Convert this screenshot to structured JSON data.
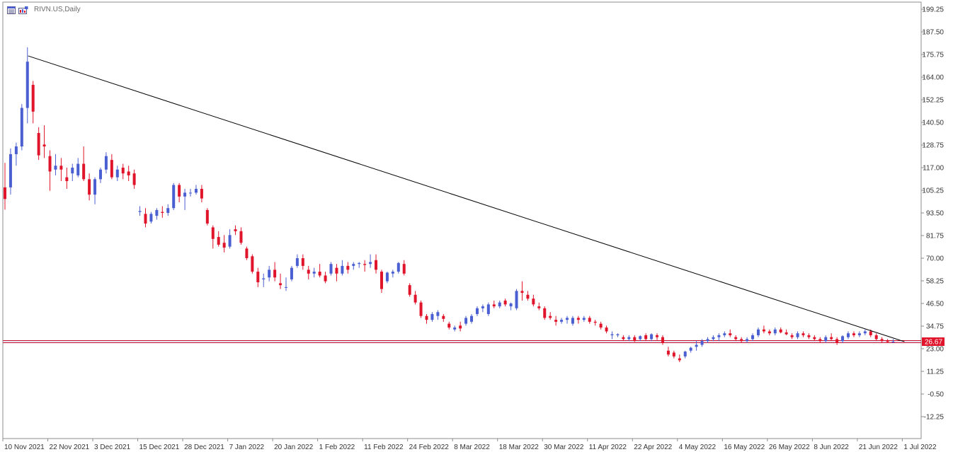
{
  "header": {
    "symbol_label": "RIVN.US,Daily",
    "icons": [
      "chart-window-icon",
      "chart-properties-icon"
    ]
  },
  "colors": {
    "bull": "#4a5fd1",
    "bear": "#e0142a",
    "trendline": "#000000",
    "price_line": "#c8102e",
    "price_badge_bg": "#e0142a",
    "grid_frame": "#8c8c8c"
  },
  "chart_data": {
    "type": "candlestick",
    "title": "RIVN.US,Daily",
    "xlabel": "",
    "ylabel": "",
    "ylim": [
      -24,
      204
    ],
    "y_ticks": [
      "199.25",
      "187.50",
      "175.75",
      "164.00",
      "152.25",
      "140.50",
      "128.75",
      "117.00",
      "105.25",
      "93.50",
      "81.75",
      "70.00",
      "58.25",
      "46.50",
      "34.75",
      "23.00",
      "11.25",
      "-0.50",
      "-12.25"
    ],
    "x_ticks": [
      "10 Nov 2021",
      "22 Nov 2021",
      "3 Dec 2021",
      "15 Dec 2021",
      "28 Dec 2021",
      "7 Jan 2022",
      "20 Jan 2022",
      "1 Feb 2022",
      "11 Feb 2022",
      "24 Feb 2022",
      "8 Mar 2022",
      "18 Mar 2022",
      "30 Mar 2022",
      "11 Apr 2022",
      "22 Apr 2022",
      "4 May 2022",
      "16 May 2022",
      "26 May 2022",
      "8 Jun 2022",
      "21 Jun 2022",
      "1 Jul 2022"
    ],
    "x_tick_index": [
      0,
      8,
      16,
      24,
      32,
      40,
      48,
      56,
      64,
      72,
      80,
      88,
      96,
      104,
      112,
      120,
      128,
      136,
      144,
      152,
      160
    ],
    "current_price": "26.67",
    "horizontal_line": 26.67,
    "trendline": {
      "from": {
        "index": 4,
        "price": 175
      },
      "to": {
        "index": 160,
        "price": 26.67
      }
    },
    "candles": [
      [
        106.75,
        119.46,
        95.2,
        100.73
      ],
      [
        106.75,
        127.0,
        103.0,
        124.0
      ],
      [
        124.0,
        130.0,
        118.0,
        128.0
      ],
      [
        128.0,
        150.0,
        126.0,
        148.0
      ],
      [
        148.0,
        179.47,
        140.0,
        172.01
      ],
      [
        160.0,
        162.0,
        140.0,
        146.07
      ],
      [
        135.0,
        138.0,
        121.0,
        123.38
      ],
      [
        129.0,
        139.0,
        122.0,
        128.0
      ],
      [
        123.0,
        126.0,
        105.0,
        115.0
      ],
      [
        116.0,
        124.0,
        113.0,
        118.0
      ],
      [
        118.0,
        122.0,
        110.0,
        116.0
      ],
      [
        112.0,
        117.0,
        106.0,
        110.0
      ],
      [
        114.0,
        119.0,
        110.0,
        117.0
      ],
      [
        113.0,
        122.0,
        112.0,
        119.0
      ],
      [
        119.0,
        128.0,
        110.0,
        111.0
      ],
      [
        111.0,
        114.0,
        100.0,
        103.0
      ],
      [
        103.0,
        112.0,
        98.0,
        111.0
      ],
      [
        111.0,
        117.0,
        109.0,
        116.0
      ],
      [
        116.0,
        125.0,
        114.0,
        123.0
      ],
      [
        121.0,
        124.0,
        111.0,
        112.0
      ],
      [
        112.0,
        118.0,
        110.0,
        116.0
      ],
      [
        117.0,
        119.0,
        111.0,
        114.0
      ],
      [
        115.0,
        118.0,
        110.0,
        113.0
      ],
      [
        114.0,
        116.0,
        106.0,
        108.0
      ],
      [
        94.0,
        97.0,
        92.0,
        94.5
      ],
      [
        93.0,
        96.0,
        86.0,
        88.0
      ],
      [
        89.0,
        94.0,
        88.0,
        93.0
      ],
      [
        92.0,
        96.0,
        90.0,
        95.0
      ],
      [
        94.0,
        97.0,
        91.0,
        93.5
      ],
      [
        93.5,
        98.0,
        92.0,
        96.0
      ],
      [
        96.0,
        109.0,
        95.0,
        108.0
      ],
      [
        108.0,
        109.0,
        99.0,
        102.0
      ],
      [
        102.0,
        106.0,
        95.0,
        104.0
      ],
      [
        104.0,
        106.0,
        102.0,
        104.0
      ],
      [
        104.0,
        108.0,
        103.0,
        106.0
      ],
      [
        106.0,
        108.0,
        99.0,
        101.0
      ],
      [
        95.0,
        96.0,
        87.0,
        88.0
      ],
      [
        86.0,
        87.0,
        75.0,
        80.0
      ],
      [
        81.0,
        84.0,
        76.0,
        77.0
      ],
      [
        78.0,
        82.0,
        73.0,
        75.5
      ],
      [
        76.0,
        85.0,
        75.0,
        82.0
      ],
      [
        85.0,
        87.0,
        82.0,
        84.0
      ],
      [
        84.0,
        86.0,
        77.0,
        78.0
      ],
      [
        75.0,
        76.0,
        69.0,
        70.0
      ],
      [
        71.0,
        72.0,
        62.0,
        63.0
      ],
      [
        63.0,
        65.0,
        55.0,
        57.5
      ],
      [
        59.0,
        62.0,
        55.0,
        59.5
      ],
      [
        60.0,
        66.0,
        58.0,
        64.0
      ],
      [
        64.0,
        68.0,
        58.0,
        60.0
      ],
      [
        57.0,
        62.0,
        54.0,
        56.0
      ],
      [
        55.0,
        60.0,
        53.0,
        55.0
      ],
      [
        59.0,
        66.0,
        58.0,
        65.0
      ],
      [
        66.0,
        72.0,
        65.0,
        70.0
      ],
      [
        70.0,
        72.0,
        64.0,
        66.0
      ],
      [
        64.0,
        66.0,
        59.0,
        62.0
      ],
      [
        62.0,
        65.0,
        60.0,
        63.0
      ],
      [
        63.0,
        67.0,
        60.0,
        61.0
      ],
      [
        61.0,
        63.0,
        57.0,
        58.0
      ],
      [
        62.0,
        68.0,
        61.0,
        67.0
      ],
      [
        65.0,
        67.0,
        58.0,
        62.0
      ],
      [
        62.0,
        69.0,
        61.0,
        66.0
      ],
      [
        66.0,
        68.0,
        62.0,
        64.0
      ],
      [
        66.0,
        68.0,
        64.0,
        67.0
      ],
      [
        67.0,
        68.0,
        65.0,
        67.5
      ],
      [
        67.0,
        69.0,
        63.0,
        66.5
      ],
      [
        67.0,
        72.0,
        65.0,
        68.0
      ],
      [
        69.0,
        72.0,
        62.0,
        64.0
      ],
      [
        63.0,
        64.0,
        52.0,
        54.0
      ],
      [
        58.0,
        63.0,
        57.0,
        62.5
      ],
      [
        62.0,
        64.0,
        60.0,
        63.0
      ],
      [
        63.0,
        68.0,
        62.0,
        67.5
      ],
      [
        67.0,
        69.0,
        61.0,
        62.0
      ],
      [
        56.0,
        57.0,
        50.0,
        51.0
      ],
      [
        51.0,
        53.0,
        46.0,
        47.0
      ],
      [
        47.0,
        48.0,
        39.0,
        40.0
      ],
      [
        40.0,
        41.0,
        36.0,
        38.0
      ],
      [
        38.0,
        42.0,
        37.0,
        41.0
      ],
      [
        40.0,
        43.0,
        38.0,
        42.0
      ],
      [
        40.0,
        41.0,
        37.0,
        38.5
      ],
      [
        36.0,
        37.0,
        33.0,
        34.0
      ],
      [
        33.0,
        35.0,
        32.0,
        34.0
      ],
      [
        35.0,
        37.0,
        32.0,
        33.5
      ],
      [
        36.0,
        40.0,
        35.0,
        39.0
      ],
      [
        37.0,
        41.0,
        36.0,
        40.0
      ],
      [
        41.0,
        45.0,
        40.0,
        44.0
      ],
      [
        44.0,
        46.0,
        42.0,
        45.0
      ],
      [
        41.0,
        47.0,
        40.0,
        46.0
      ],
      [
        46.0,
        48.0,
        44.0,
        45.0
      ],
      [
        45.0,
        48.0,
        44.0,
        47.0
      ],
      [
        48.0,
        49.0,
        45.0,
        46.0
      ],
      [
        45.0,
        47.0,
        43.0,
        46.5
      ],
      [
        44.0,
        54.0,
        43.0,
        53.0
      ],
      [
        53.0,
        58.0,
        48.0,
        52.0
      ],
      [
        51.0,
        53.0,
        48.0,
        49.0
      ],
      [
        49.0,
        51.0,
        45.0,
        46.0
      ],
      [
        45.0,
        47.0,
        43.0,
        44.0
      ],
      [
        44.0,
        45.0,
        38.0,
        39.0
      ],
      [
        40.0,
        42.0,
        38.0,
        39.0
      ],
      [
        38.0,
        40.0,
        35.0,
        37.0
      ],
      [
        37.0,
        39.0,
        36.0,
        38.0
      ],
      [
        38.0,
        40.0,
        36.0,
        39.0
      ],
      [
        36.0,
        40.0,
        35.0,
        39.0
      ],
      [
        39.0,
        40.0,
        36.0,
        38.0
      ],
      [
        38.0,
        40.0,
        37.0,
        39.0
      ],
      [
        39.0,
        40.0,
        36.0,
        37.0
      ],
      [
        37.0,
        38.0,
        35.0,
        36.5
      ],
      [
        36.0,
        37.0,
        33.0,
        34.0
      ],
      [
        34.0,
        35.0,
        31.0,
        32.0
      ],
      [
        30.0,
        32.0,
        28.0,
        30.5
      ],
      [
        30.0,
        31.0,
        29.0,
        30.5
      ],
      [
        29.0,
        30.0,
        27.0,
        28.0
      ],
      [
        28.0,
        30.0,
        27.0,
        29.0
      ],
      [
        29.0,
        30.0,
        26.5,
        27.0
      ],
      [
        28.0,
        30.0,
        27.0,
        29.5
      ],
      [
        30.0,
        31.0,
        27.0,
        28.0
      ],
      [
        28.0,
        31.0,
        27.0,
        30.5
      ],
      [
        30.0,
        31.0,
        27.5,
        29.0
      ],
      [
        29.0,
        30.0,
        25.0,
        26.0
      ],
      [
        22.0,
        24.0,
        19.0,
        20.0
      ],
      [
        21.0,
        22.0,
        18.0,
        19.0
      ],
      [
        18.0,
        20.0,
        16.0,
        17.0
      ],
      [
        19.0,
        22.0,
        18.0,
        21.5
      ],
      [
        22.0,
        24.0,
        21.0,
        23.5
      ],
      [
        24.0,
        27.0,
        22.0,
        25.0
      ],
      [
        25.0,
        28.0,
        24.0,
        27.0
      ],
      [
        27.0,
        29.0,
        26.0,
        28.0
      ],
      [
        28.0,
        30.0,
        27.0,
        29.0
      ],
      [
        29.0,
        31.0,
        27.0,
        30.0
      ],
      [
        30.0,
        32.0,
        29.0,
        31.0
      ],
      [
        31.0,
        33.0,
        29.0,
        30.0
      ],
      [
        29.0,
        30.0,
        27.0,
        28.0
      ],
      [
        28.0,
        29.0,
        26.0,
        27.0
      ],
      [
        27.0,
        29.0,
        26.0,
        28.0
      ],
      [
        28.0,
        31.0,
        27.0,
        30.0
      ],
      [
        30.0,
        34.0,
        29.0,
        33.0
      ],
      [
        33.0,
        35.0,
        31.0,
        32.0
      ],
      [
        32.0,
        33.0,
        30.0,
        31.0
      ],
      [
        31.0,
        34.0,
        30.0,
        33.0
      ],
      [
        33.0,
        34.0,
        31.0,
        31.5
      ],
      [
        31.5,
        33.0,
        30.0,
        30.5
      ],
      [
        30.0,
        31.0,
        28.0,
        29.0
      ],
      [
        29.0,
        32.0,
        28.0,
        31.0
      ],
      [
        31.0,
        32.0,
        29.0,
        30.0
      ],
      [
        30.0,
        31.0,
        28.0,
        29.0
      ],
      [
        29.0,
        30.0,
        27.0,
        28.0
      ],
      [
        28.0,
        29.0,
        26.0,
        27.0
      ],
      [
        27.0,
        30.0,
        26.0,
        29.0
      ],
      [
        29.0,
        31.0,
        27.0,
        28.0
      ],
      [
        28.0,
        29.0,
        25.0,
        26.0
      ],
      [
        27.0,
        30.0,
        26.0,
        29.5
      ],
      [
        29.0,
        32.0,
        28.0,
        31.0
      ],
      [
        31.0,
        32.0,
        29.0,
        30.0
      ],
      [
        30.0,
        32.0,
        29.0,
        31.0
      ],
      [
        31.0,
        33.0,
        30.0,
        32.0
      ],
      [
        32.0,
        33.0,
        29.0,
        30.0
      ],
      [
        30.0,
        31.0,
        27.0,
        28.0
      ],
      [
        28.0,
        29.0,
        26.0,
        27.0
      ],
      [
        27.0,
        28.0,
        26.0,
        26.5
      ],
      [
        26.5,
        28.0,
        26.0,
        26.67
      ]
    ]
  }
}
